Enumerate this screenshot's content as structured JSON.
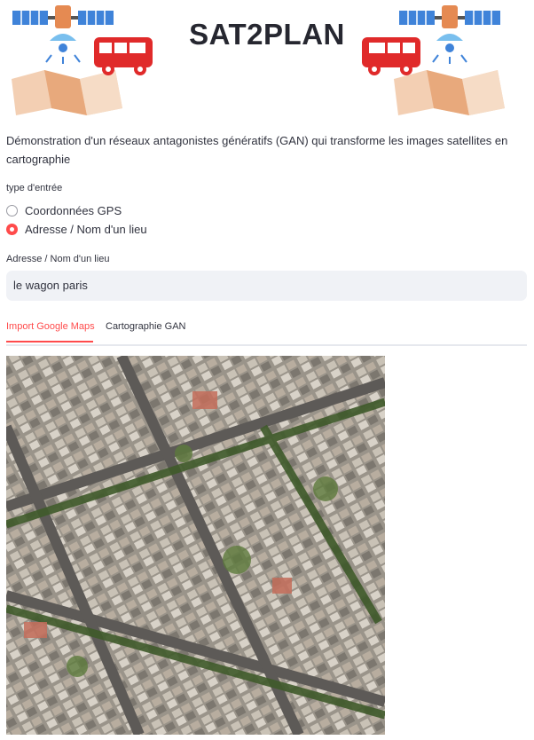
{
  "app": {
    "title": "SAT2PLAN"
  },
  "description": "Démonstration d'un réseaux antagonistes génératifs (GAN) qui transforme les images satellites en cartographie",
  "input_type": {
    "label": "type d'entrée",
    "options": [
      {
        "label": "Coordonnées GPS",
        "selected": false
      },
      {
        "label": "Adresse / Nom d'un lieu",
        "selected": true
      }
    ]
  },
  "address": {
    "label": "Adresse / Nom d'un lieu",
    "value": "le wagon paris"
  },
  "tabs": [
    {
      "label": "Import Google Maps",
      "active": true
    },
    {
      "label": "Cartographie GAN",
      "active": false
    }
  ],
  "colors": {
    "accent": "#ff4b4b",
    "input_bg": "#f0f2f6",
    "text": "#31333f"
  }
}
